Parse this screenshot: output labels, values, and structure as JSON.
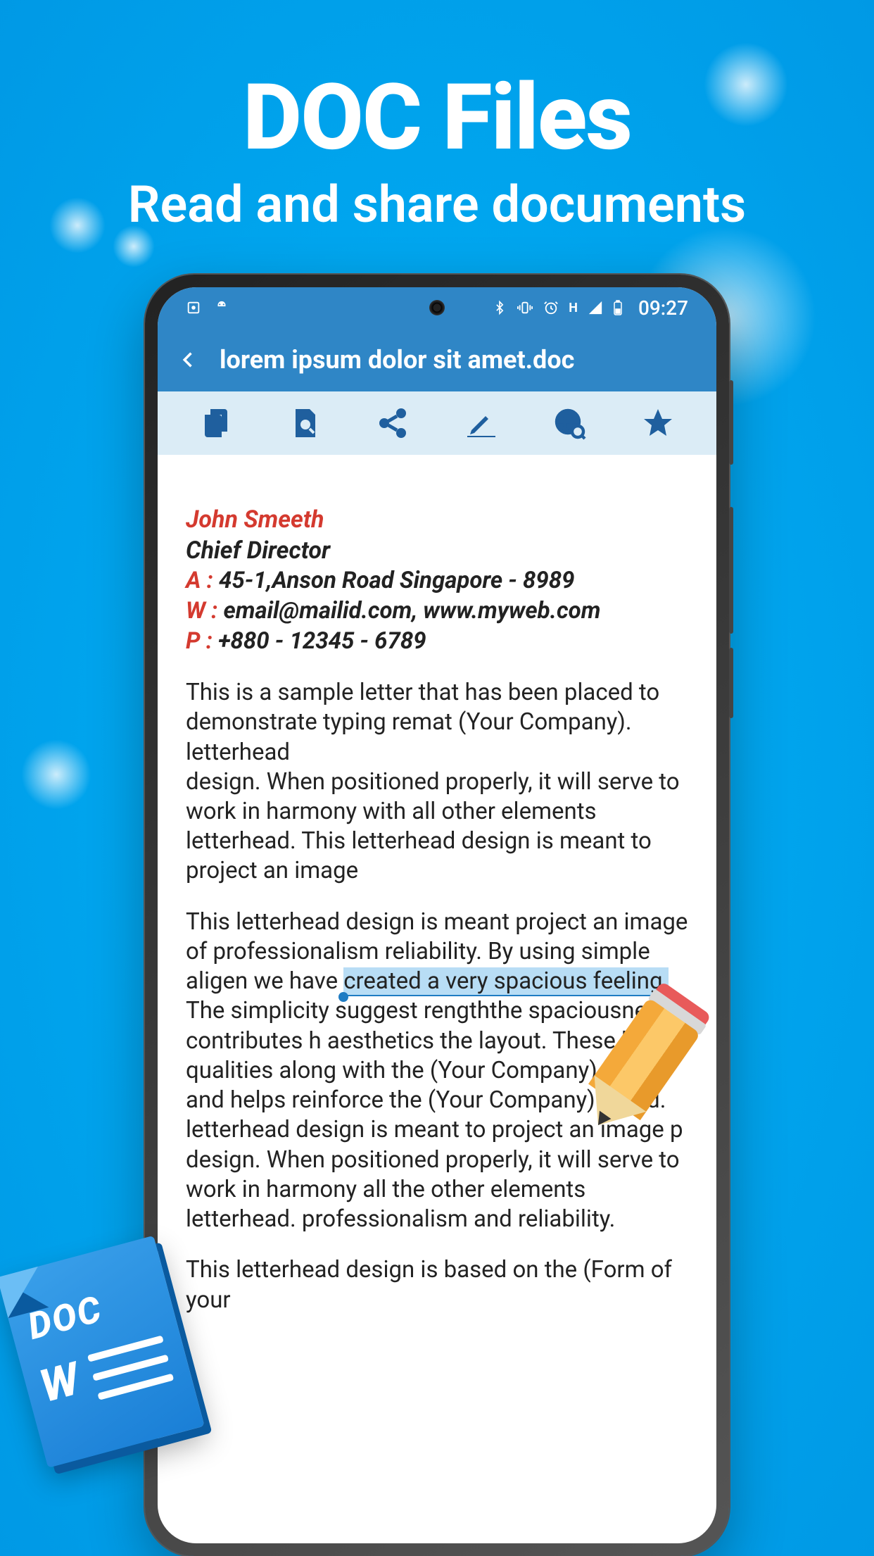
{
  "promo": {
    "title": "DOC Files",
    "subtitle": "Read and share documents"
  },
  "statusbar": {
    "time": "09:27",
    "signal_label": "H"
  },
  "appbar": {
    "filename": "lorem ipsum dolor sit amet.doc"
  },
  "toolbar": {
    "copy": "copy",
    "search": "search-in-doc",
    "share": "share",
    "highlight": "highlight",
    "web": "web-search",
    "star": "favorite"
  },
  "document": {
    "name": "John Smeeth",
    "role": "Chief Director",
    "address_label": "A  :",
    "address": "45-1,Anson Road Singapore - 8989",
    "web_label": "W :",
    "web": "email@mailid.com, www.myweb.com",
    "phone_label": "P  :",
    "phone": "+880 - 12345 - 6789",
    "para1": "This is a sample letter that has been placed to demonstrate typing remat (Your Company). letterhead",
    "para1b": "design. When positioned properly, it will serve to work in harmony with all other elements letterhead. This letterhead design is meant to project an image",
    "para2a": "This letterhead design is meant project an image of professionalism reliability. By using simple aligen we have ",
    "para2_highlight": "created a very spacious feeling.",
    "para2b": " The simplicity suggest  rengththe spaciousnes contributes h aesthetics the layout. These basic qualities along with the (Your Company) look and helps reinforce the (Your Company) brand. letterhead design is meant to project an image p",
    "para2c": "design. When positioned properly, it will serve to work in harmony all the other elements letterhead. professionalism and reliability.",
    "para3": "This letterhead design is based on the (Form of your"
  },
  "badge": {
    "label": "DOC",
    "w": "W"
  }
}
